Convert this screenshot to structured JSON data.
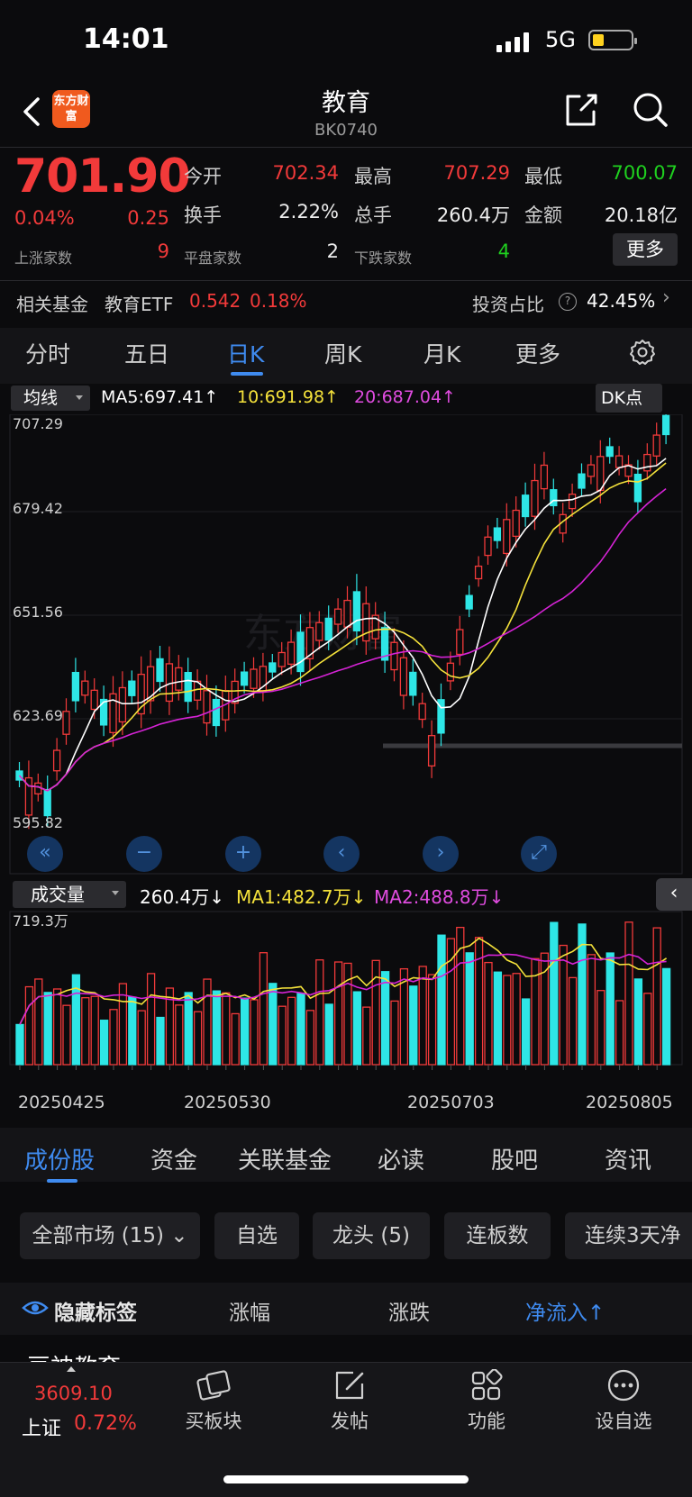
{
  "status_bar": {
    "time": "14:01",
    "network": "5G"
  },
  "header": {
    "logo_text": "东方财富",
    "title": "教育",
    "code": "BK0740"
  },
  "quote": {
    "price": "701.90",
    "change_pct": "0.04%",
    "change": "0.25",
    "open_label": "今开",
    "open": "702.34",
    "high_label": "最高",
    "high": "707.29",
    "low_label": "最低",
    "low": "700.07",
    "turnover_label": "换手",
    "turnover": "2.22%",
    "volume_label": "总手",
    "volume": "260.4万",
    "amount_label": "金额",
    "amount": "20.18亿",
    "up_count_label": "上涨家数",
    "up_count": "9",
    "flat_count_label": "平盘家数",
    "flat_count": "2",
    "down_count_label": "下跌家数",
    "down_count": "4",
    "more_label": "更多"
  },
  "fund_row": {
    "label": "相关基金",
    "fund_name": "教育ETF",
    "fund_price": "0.542",
    "fund_pct": "0.18%",
    "ratio_label": "投资占比",
    "ratio": "42.45%",
    "help_icon": "?"
  },
  "period_tabs": [
    {
      "label": "分时"
    },
    {
      "label": "五日"
    },
    {
      "label": "日K",
      "active": true
    },
    {
      "label": "周K"
    },
    {
      "label": "月K"
    },
    {
      "label": "更多"
    }
  ],
  "ma_legend": {
    "select": "均线",
    "ma5": "MA5:697.41↑",
    "ma10": "10:691.98↑",
    "ma20": "20:687.04↑",
    "dk": "DK点",
    "colors": {
      "ma5": "#ffffff",
      "ma10": "#f5e23b",
      "ma20": "#d623d6",
      "up": "#f23a3a",
      "down": "#2ee6e6"
    }
  },
  "kline_axis": [
    "707.29",
    "679.42",
    "651.56",
    "623.69",
    "595.82"
  ],
  "watermark": "东方财富",
  "controls": [
    "«",
    "−",
    "+",
    "‹",
    "›",
    "⤢"
  ],
  "volume_legend": {
    "select": "成交量",
    "vol": "260.4万↓",
    "ma1": "MA1:482.7万↓",
    "ma2": "MA2:488.8万↓",
    "max": "719.3万",
    "collapse": "‹"
  },
  "dates": [
    "20250425",
    "20250530",
    "20250703",
    "20250805"
  ],
  "section_tabs": [
    {
      "label": "成份股",
      "active": true
    },
    {
      "label": "资金"
    },
    {
      "label": "关联基金"
    },
    {
      "label": "必读"
    },
    {
      "label": "股吧"
    },
    {
      "label": "资讯"
    }
  ],
  "filter_chips": [
    "全部市场 (15)",
    "自选",
    "龙头 (5)",
    "连板数",
    "连续3天净"
  ],
  "table_head": {
    "hide_tags": "隐藏标签",
    "col1": "涨幅",
    "col2": "涨跌",
    "col3": "净流入↑"
  },
  "partial_row": "豆神教育",
  "bottom_nav": {
    "index_value": "3609.10",
    "index_name": "上证",
    "index_pct": "0.72%",
    "items": [
      {
        "label": "买板块"
      },
      {
        "label": "发帖"
      },
      {
        "label": "功能"
      },
      {
        "label": "设自选"
      }
    ]
  }
}
